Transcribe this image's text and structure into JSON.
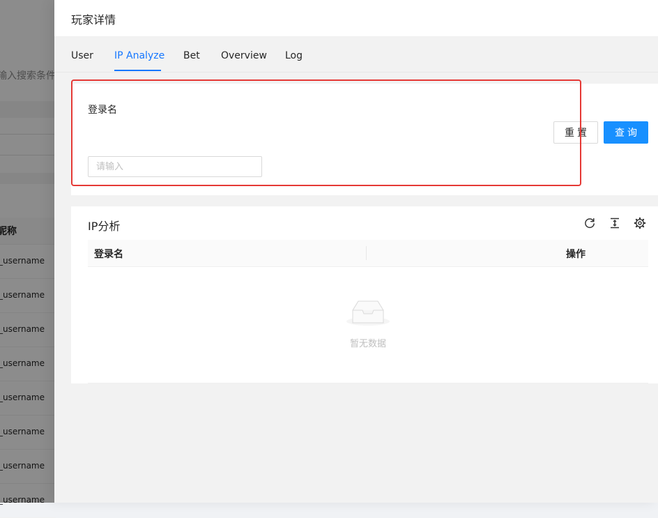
{
  "background": {
    "search_hint": "输入搜索条件",
    "column_header": "昵称",
    "rows": [
      "_username",
      "_username",
      "_username",
      "_username",
      "_username",
      "_username",
      "_username",
      "_username"
    ]
  },
  "drawer": {
    "title": "玩家详情",
    "tabs": [
      {
        "label": "User",
        "active": false
      },
      {
        "label": "IP Analyze",
        "active": true
      },
      {
        "label": "Bet",
        "active": false
      },
      {
        "label": "Overview",
        "active": false
      },
      {
        "label": "Log",
        "active": false
      }
    ],
    "search": {
      "label": "登录名",
      "placeholder": "请输入",
      "value": "",
      "reset_label": "重置",
      "query_label": "查询"
    },
    "table": {
      "title": "IP分析",
      "tools": [
        "reload-icon",
        "density-icon",
        "settings-icon"
      ],
      "columns": [
        "登录名",
        "操作"
      ],
      "empty_text": "暂无数据"
    }
  },
  "colors": {
    "primary": "#1890ff",
    "active_tab": "#1677ff",
    "highlight": "#e53935"
  }
}
